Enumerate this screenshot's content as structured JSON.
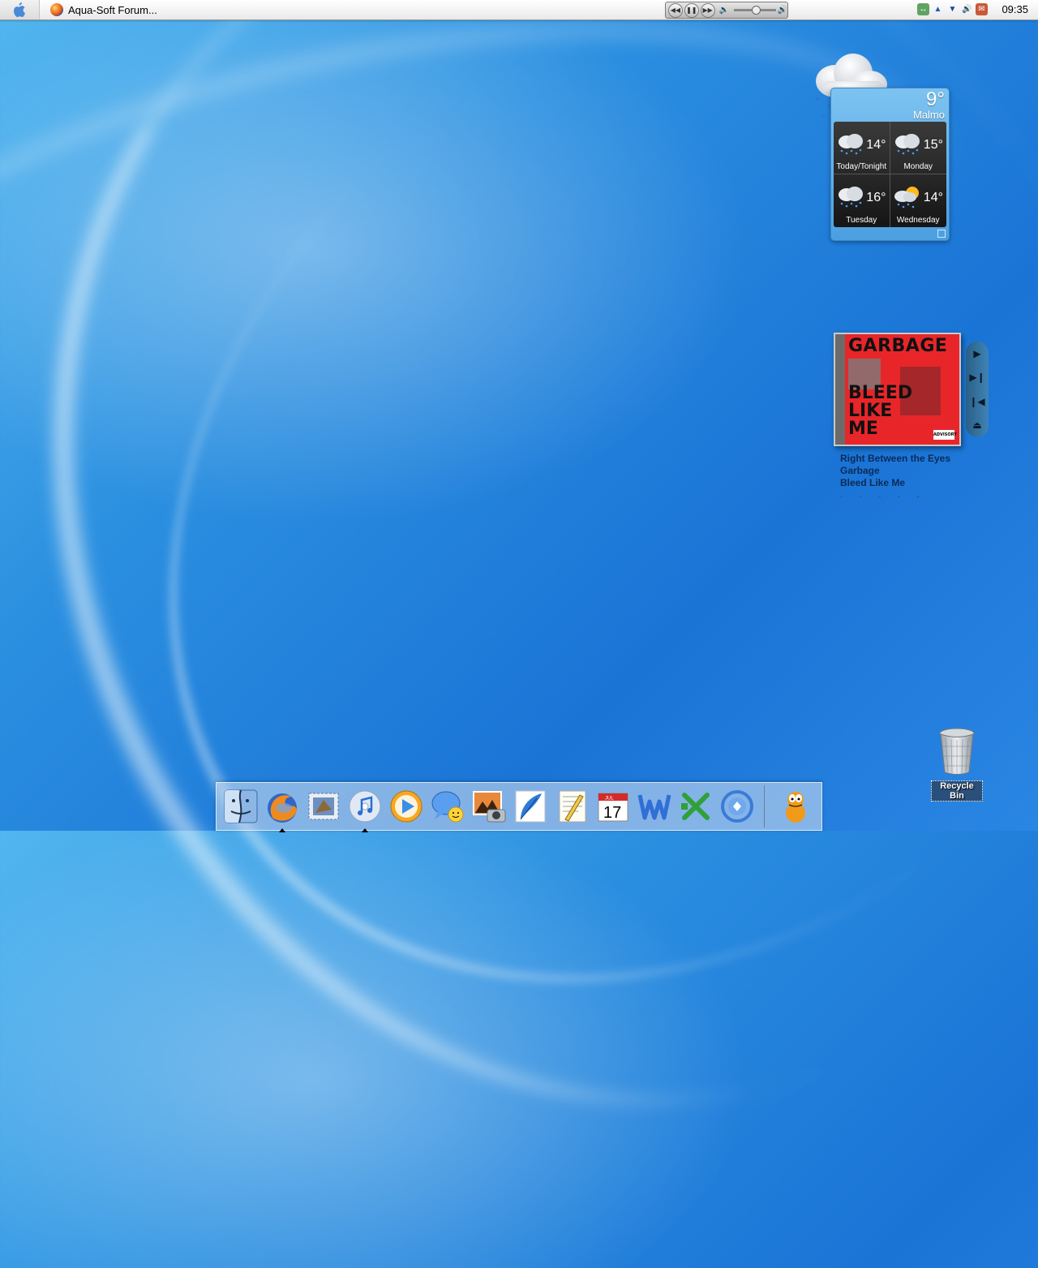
{
  "menubar": {
    "app_title": "Aqua-Soft Forum...",
    "clock": "09:35"
  },
  "weather": {
    "current_temp": "9°",
    "city": "Malmo",
    "forecast": [
      {
        "day": "Today/Tonight",
        "temp": "14°",
        "icon": "rain-icon"
      },
      {
        "day": "Monday",
        "temp": "15°",
        "icon": "rain-icon"
      },
      {
        "day": "Tuesday",
        "temp": "16°",
        "icon": "rain-icon"
      },
      {
        "day": "Wednesday",
        "temp": "14°",
        "icon": "sun-rain-icon"
      }
    ]
  },
  "music": {
    "album_art": {
      "band": "GARBAGE",
      "title": "BLEED LIKE ME"
    },
    "track": "Right Between the Eyes",
    "artist": "Garbage",
    "album": "Bleed Like Me",
    "rating_dots": "• • • • •"
  },
  "desktop": {
    "recycle_bin_label": "Recycle Bin"
  },
  "dock": {
    "items": [
      {
        "name": "finder-icon",
        "running": false
      },
      {
        "name": "firefox-icon",
        "running": true
      },
      {
        "name": "mail-icon",
        "running": false
      },
      {
        "name": "itunes-icon",
        "running": true
      },
      {
        "name": "quicktime-icon",
        "running": false
      },
      {
        "name": "ichat-icon",
        "running": false
      },
      {
        "name": "iphoto-icon",
        "running": false
      },
      {
        "name": "feather-icon",
        "running": false
      },
      {
        "name": "textedit-icon",
        "running": false
      },
      {
        "name": "ical-icon",
        "running": false
      },
      {
        "name": "word-icon",
        "running": false
      },
      {
        "name": "excel-icon",
        "running": false
      },
      {
        "name": "sync-icon",
        "running": false
      },
      {
        "name": "garfield-icon",
        "running": false
      }
    ],
    "calendar_month": "JUL",
    "calendar_day": "17"
  },
  "colors": {
    "desktop": "#2b8fe0",
    "weather_panel": "#4c9fe0",
    "album_red": "#e8262a"
  }
}
